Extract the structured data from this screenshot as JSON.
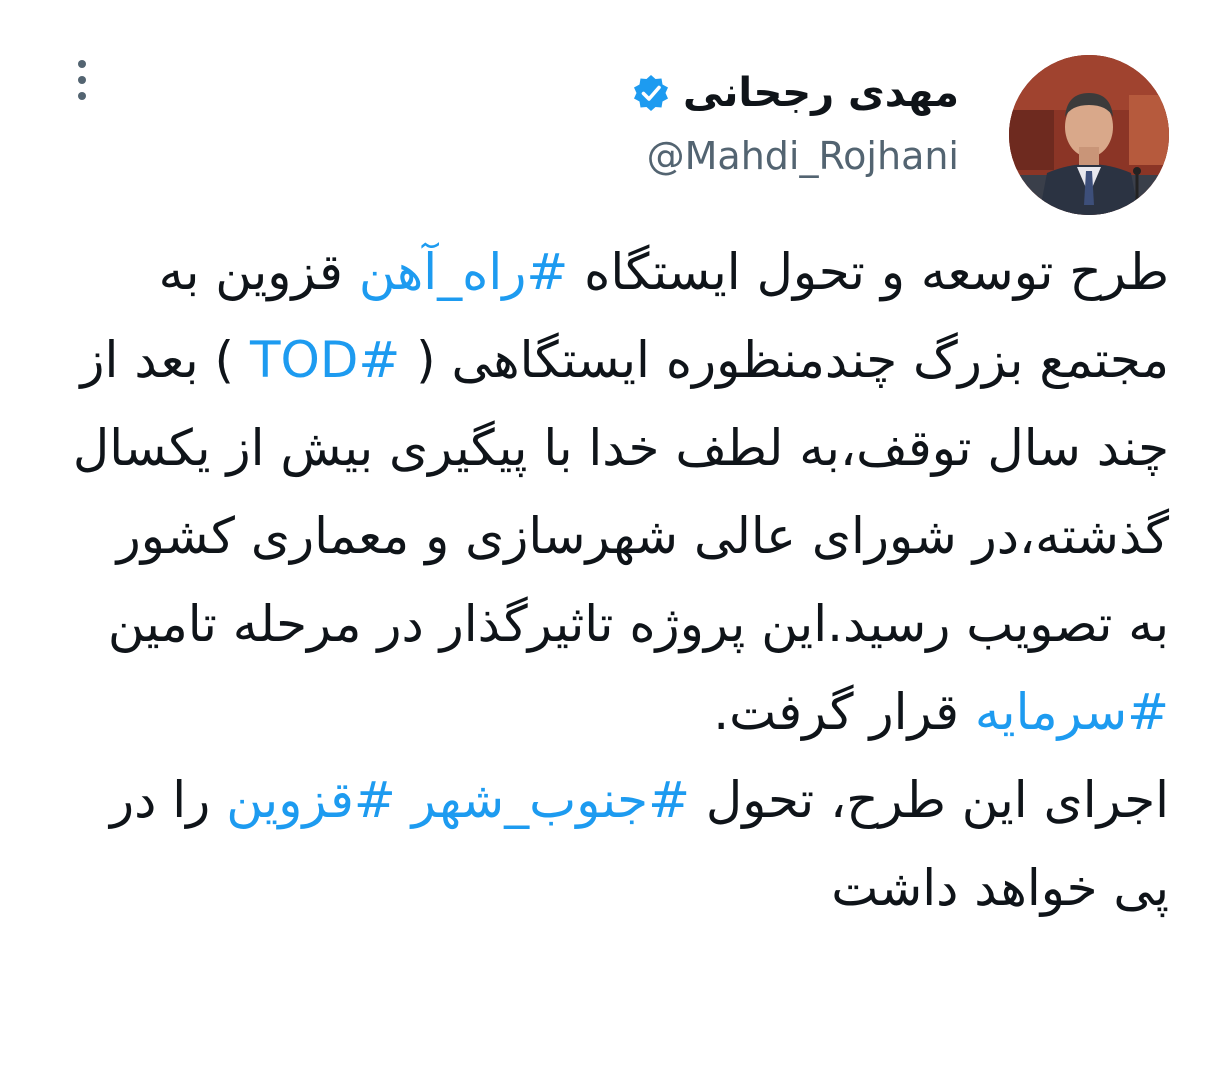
{
  "author": {
    "display_name": "مهدی رجحانی",
    "handle": "@Mahdi_Rojhani",
    "verified": true
  },
  "menu_icon": "more-vertical-icon",
  "colors": {
    "hashtag": "#1d9bf0",
    "verified": "#1d9bf0",
    "text": "#0f1419",
    "muted": "#536471"
  },
  "tweet": {
    "p1": {
      "s1": "طرح توسعه و تحول ایستگاه ",
      "h1": "#راه_آهن",
      "s2": " قزوین به مجتمع بزرگ چندمنظوره ایستگاهی (",
      "h2": "#TOD",
      "s3": ") بعد از چند سال توقف،به لطف خدا با پیگیری بیش از یکسال گذشته،در شورای عالی شهرسازی و معماری کشور به تصویب رسید.این پروژه تاثیرگذار در مرحله تامین ",
      "h3": "#سرمایه",
      "s4": " قرار گرفت."
    },
    "p2": {
      "s1": "اجرای این طرح، تحول ",
      "h1": "#جنوب_شهر",
      "s2": " ",
      "h2": "#قزوین",
      "s3": " را در پی خواهد داشت"
    }
  }
}
